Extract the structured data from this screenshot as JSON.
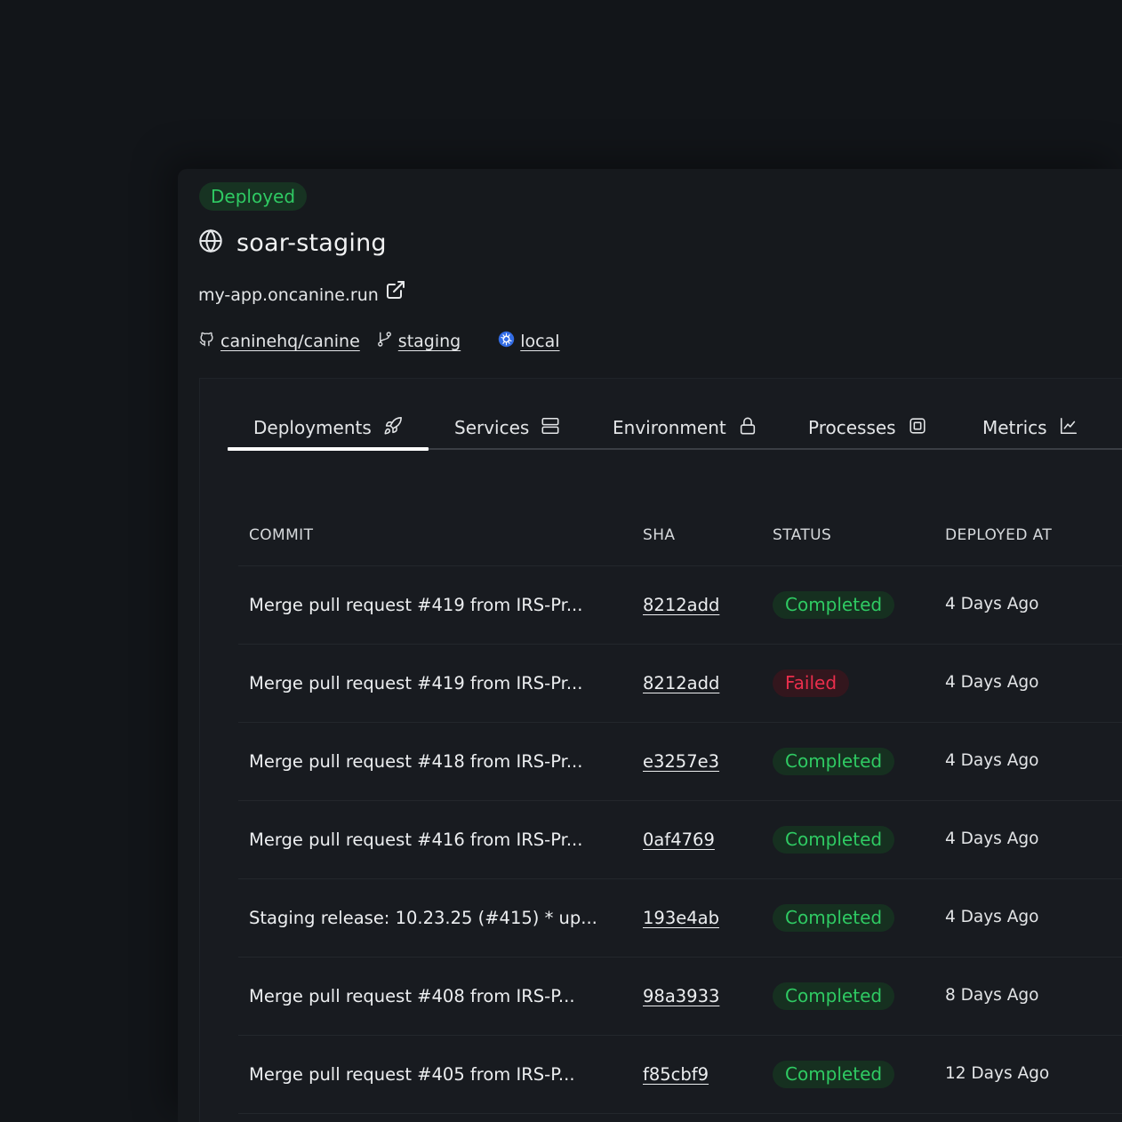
{
  "project": {
    "status_badge": "Deployed",
    "title": "soar-staging",
    "url": "my-app.oncanine.run",
    "repo": "caninehq/canine",
    "branch": "staging",
    "cluster": "local"
  },
  "tabs": [
    {
      "label": "Deployments",
      "icon": "rocket-icon",
      "active": true
    },
    {
      "label": "Services",
      "icon": "server-icon",
      "active": false
    },
    {
      "label": "Environment",
      "icon": "lock-icon",
      "active": false
    },
    {
      "label": "Processes",
      "icon": "cpu-icon",
      "active": false
    },
    {
      "label": "Metrics",
      "icon": "chart-icon",
      "active": false
    }
  ],
  "table": {
    "headers": {
      "commit": "COMMIT",
      "sha": "SHA",
      "status": "STATUS",
      "deployed_at": "DEPLOYED AT"
    },
    "rows": [
      {
        "commit": "Merge pull request #419 from IRS-Pr...",
        "sha": "8212add",
        "status": "Completed",
        "deployed_at": "4 Days Ago"
      },
      {
        "commit": "Merge pull request #419 from IRS-Pr...",
        "sha": "8212add",
        "status": "Failed",
        "deployed_at": "4 Days Ago"
      },
      {
        "commit": "Merge pull request #418 from IRS-Pr...",
        "sha": "e3257e3",
        "status": "Completed",
        "deployed_at": "4 Days Ago"
      },
      {
        "commit": "Merge pull request #416 from IRS-Pr...",
        "sha": "0af4769",
        "status": "Completed",
        "deployed_at": "4 Days Ago"
      },
      {
        "commit": "Staging release: 10.23.25 (#415) * up...",
        "sha": "193e4ab",
        "status": "Completed",
        "deployed_at": "4 Days Ago"
      },
      {
        "commit": "Merge pull request #408 from IRS-P...",
        "sha": "98a3933",
        "status": "Completed",
        "deployed_at": "8 Days Ago"
      },
      {
        "commit": "Merge pull request #405 from IRS-P...",
        "sha": "f85cbf9",
        "status": "Completed",
        "deployed_at": "12 Days Ago"
      }
    ]
  },
  "colors": {
    "success": "#2fca63",
    "danger": "#ea2e4c",
    "background": "#121519",
    "k8s_blue": "#326ce5"
  }
}
